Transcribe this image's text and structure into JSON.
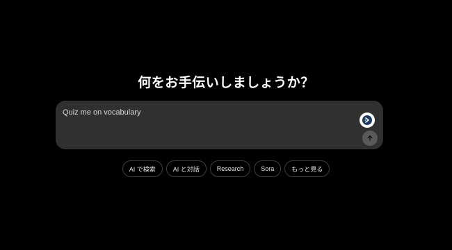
{
  "headline": "何をお手伝いしましょうか？",
  "composer": {
    "input_text": "Quiz me on vocabulary",
    "extension_icon": "ai-extension-icon",
    "send_icon": "arrow-up-icon"
  },
  "chips": [
    "AI で検索",
    "AI と対話",
    "Research",
    "Sora",
    "もっと見る"
  ],
  "colors": {
    "background": "#000000",
    "composer": "#303030",
    "chip_border": "#3f3f3f",
    "send_button": "#5a5a5a"
  }
}
